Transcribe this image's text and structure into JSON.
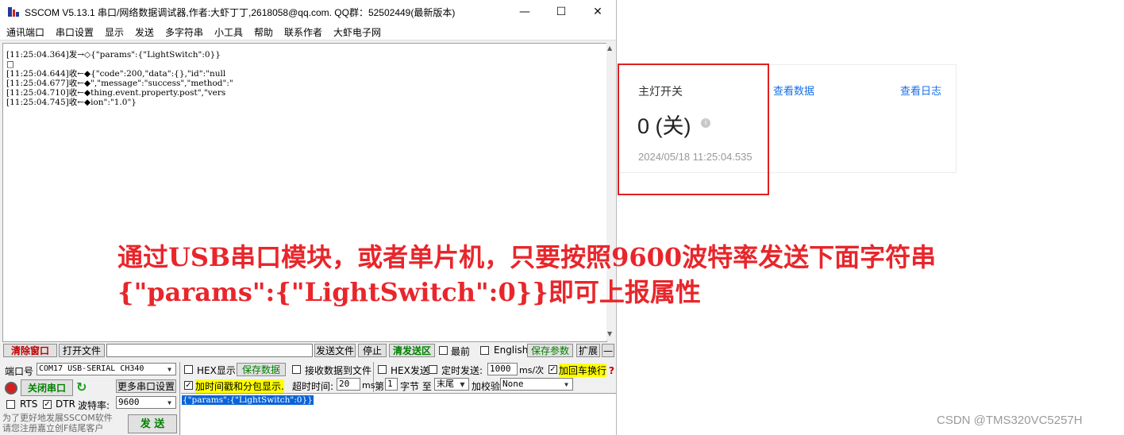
{
  "window": {
    "title": "SSCOM V5.13.1 串口/网络数据调试器,作者:大虾丁丁,2618058@qq.com. QQ群：52502449(最新版本)",
    "minimize_glyph": "—",
    "maximize_glyph": "☐",
    "close_glyph": "✕"
  },
  "menu": [
    "通讯端口",
    "串口设置",
    "显示",
    "发送",
    "多字符串",
    "小工具",
    "帮助",
    "联系作者",
    "大虾电子网"
  ],
  "receive": {
    "lines": [
      "[11:25:04.364]发→◇{\"params\":{\"LightSwitch\":0}}",
      "□",
      "[11:25:04.644]收←◆{\"code\":200,\"data\":{},\"id\":\"null",
      "[11:25:04.677]收←◆\",\"message\":\"success\",\"method\":\"",
      "[11:25:04.710]收←◆thing.event.property.post\",\"vers",
      "[11:25:04.745]收←◆ion\":\"1.0\"}"
    ]
  },
  "toolbar": {
    "clear_window": "清除窗口",
    "open_file": "打开文件",
    "send_file": "发送文件",
    "stop": "停止",
    "clear_send": "清发送区",
    "topmost": "最前",
    "english": "English",
    "save_params": "保存参数",
    "expand": "扩展",
    "collapse": "—"
  },
  "port": {
    "port_label": "端口号",
    "port_value": "COM17 USB-SERIAL CH340",
    "close_port": "关闭串口",
    "more_settings": "更多串口设置",
    "rts": "RTS",
    "dtr": "DTR",
    "baud_label": "波特率:",
    "baud_value": "9600"
  },
  "options": {
    "hex_display": "HEX显示",
    "save_data": "保存数据",
    "recv_to_file": "接收数据到文件",
    "hex_send": "HEX发送",
    "timed_send": "定时发送:",
    "interval": "1000",
    "interval_unit": "ms/次",
    "add_crlf": "加回车换行",
    "help_mark": "?",
    "timestamp": "加时间戳和分包显示.",
    "timeout_label": "超时时间:",
    "timeout_value": "20",
    "timeout_unit": "ms",
    "byte_prefix": "第",
    "byte_index": "1",
    "byte_unit": "字节 至",
    "byte_end": "末尾",
    "checksum_label": "加校验",
    "checksum_value": "None"
  },
  "send": {
    "text": "{\"params\":{\"LightSwitch\":0}}",
    "button": "发 送"
  },
  "promo": {
    "line1": "为了更好地发展SSCOM软件",
    "line2": "请您注册嘉立创F结尾客户"
  },
  "device_panel": {
    "property_name": "主灯开关",
    "property_value": "0 (关)",
    "info_glyph": "i",
    "timestamp": "2024/05/18 11:25:04.535",
    "view_data": "查看数据",
    "view_log": "查看日志"
  },
  "annotation": {
    "line1": "通过USB串口模块，或者单片机，只要按照9600波特率发送下面字符串",
    "line2": "{\"params\":{\"LightSwitch\":0}}即可上报属性"
  },
  "watermark": "CSDN @TMS320VC5257H",
  "colors": {
    "annotation_red": "#e8262b",
    "link_blue": "#1670e8",
    "highlight_yellow": "#ffff00",
    "selection_blue": "#0a64d8"
  }
}
